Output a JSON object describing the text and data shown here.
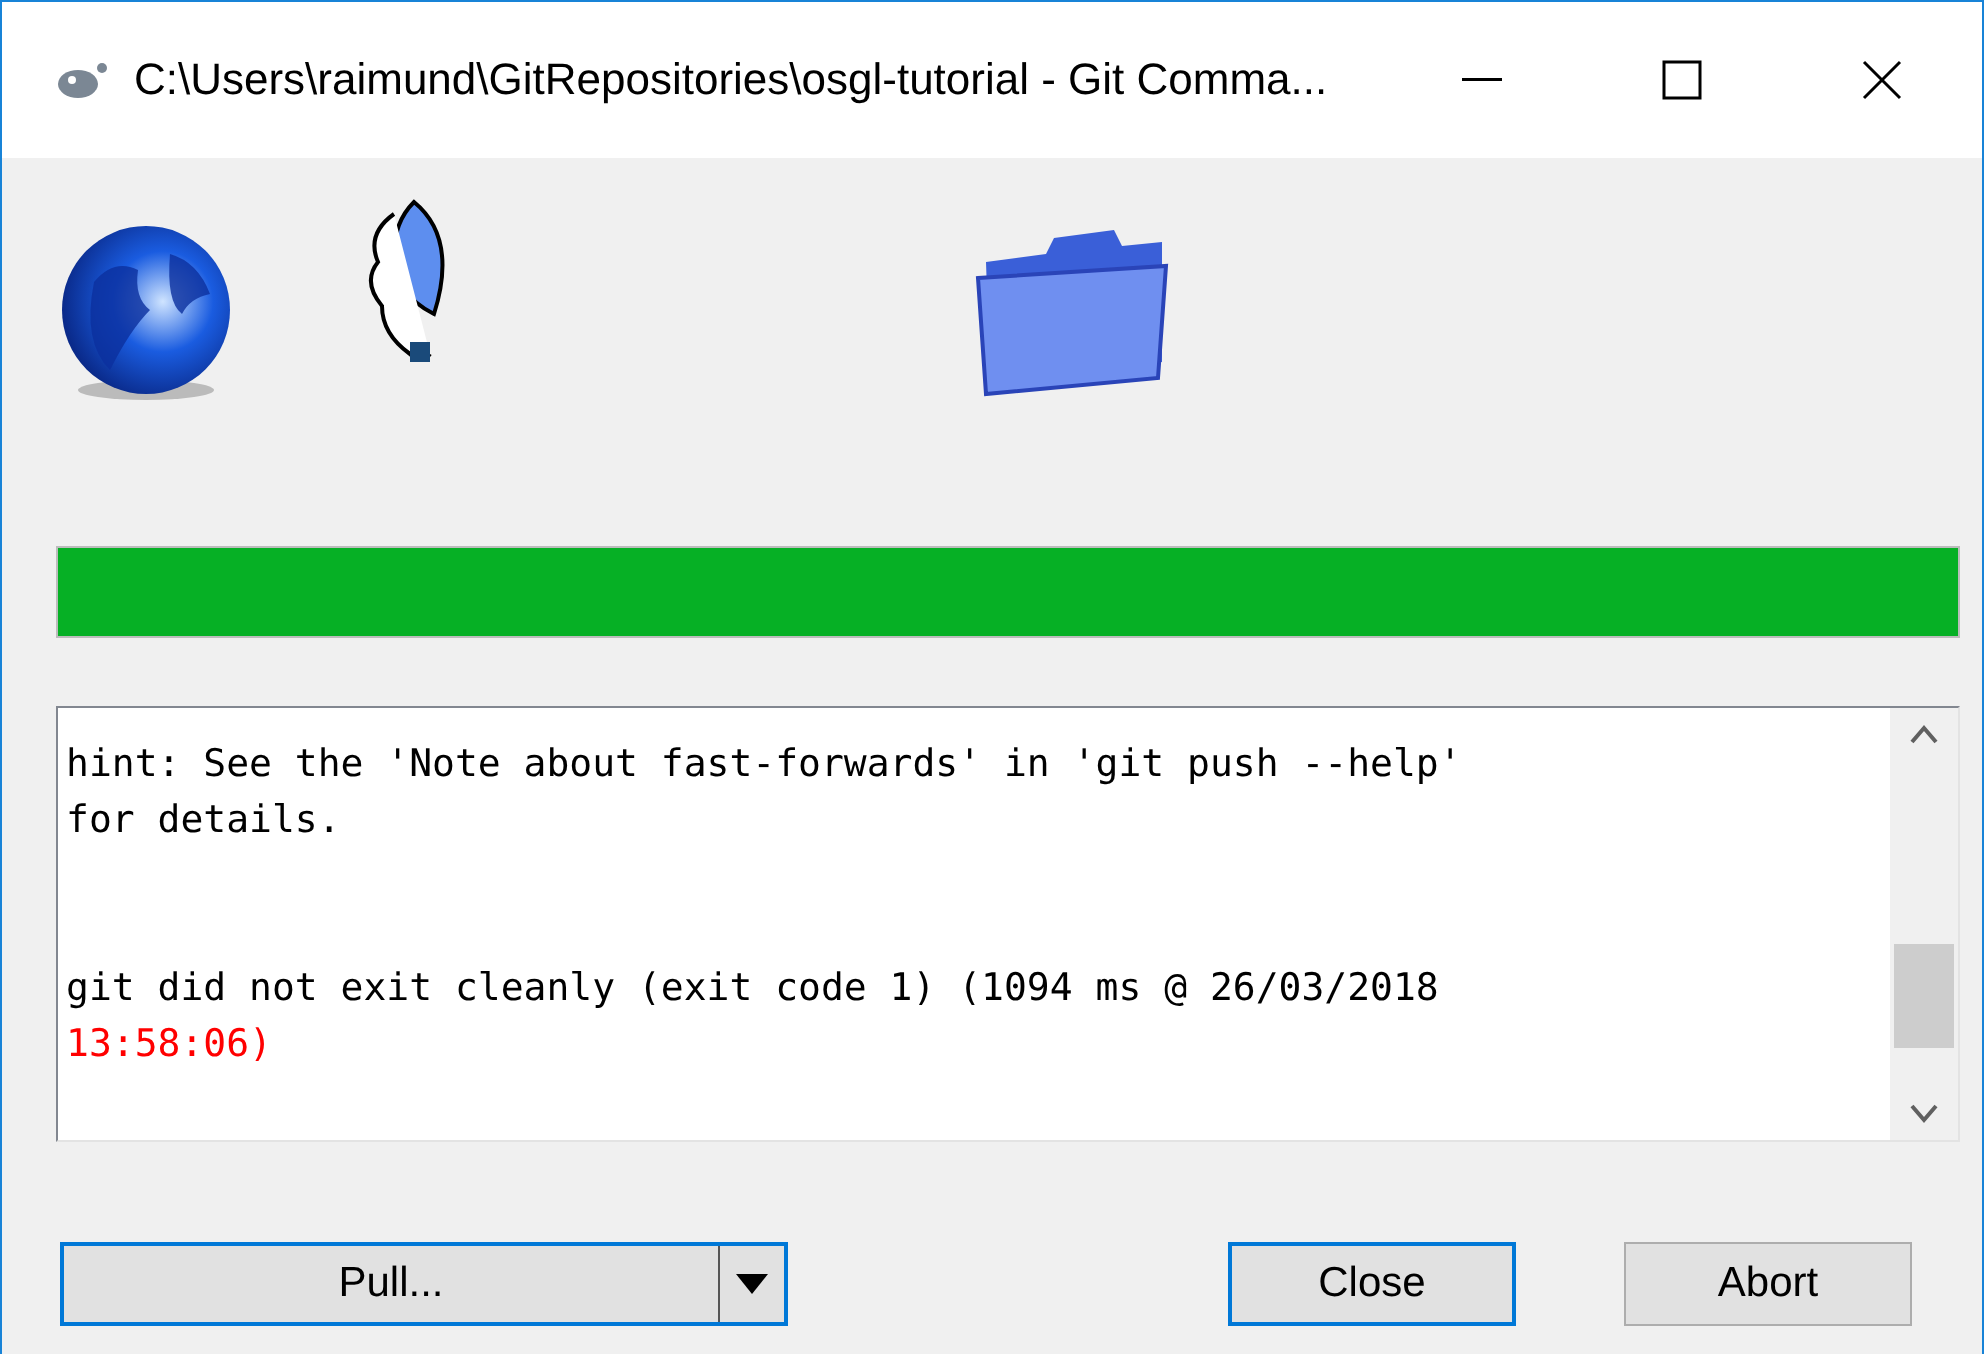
{
  "window": {
    "title": "C:\\Users\\raimund\\GitRepositories\\osgl-tutorial - Git Comma..."
  },
  "progress": {
    "level": 1
  },
  "log": [
    {
      "kind": "output",
      "text": "hint: See the 'Note about fast-forwards' in 'git push --help'"
    },
    {
      "kind": "output",
      "text": "for details."
    },
    {
      "kind": "status",
      "text": "git did not exit cleanly (exit code 1) (1094 ms @ 26/03/2018"
    },
    {
      "kind": "error",
      "text": "13:58:06)"
    }
  ],
  "buttons": [
    {
      "kind": "split",
      "label": "Pull...",
      "focused": true
    },
    {
      "kind": "plain",
      "label": "Close",
      "focused": true
    },
    {
      "kind": "plain",
      "label": "Abort",
      "focused": false
    }
  ]
}
